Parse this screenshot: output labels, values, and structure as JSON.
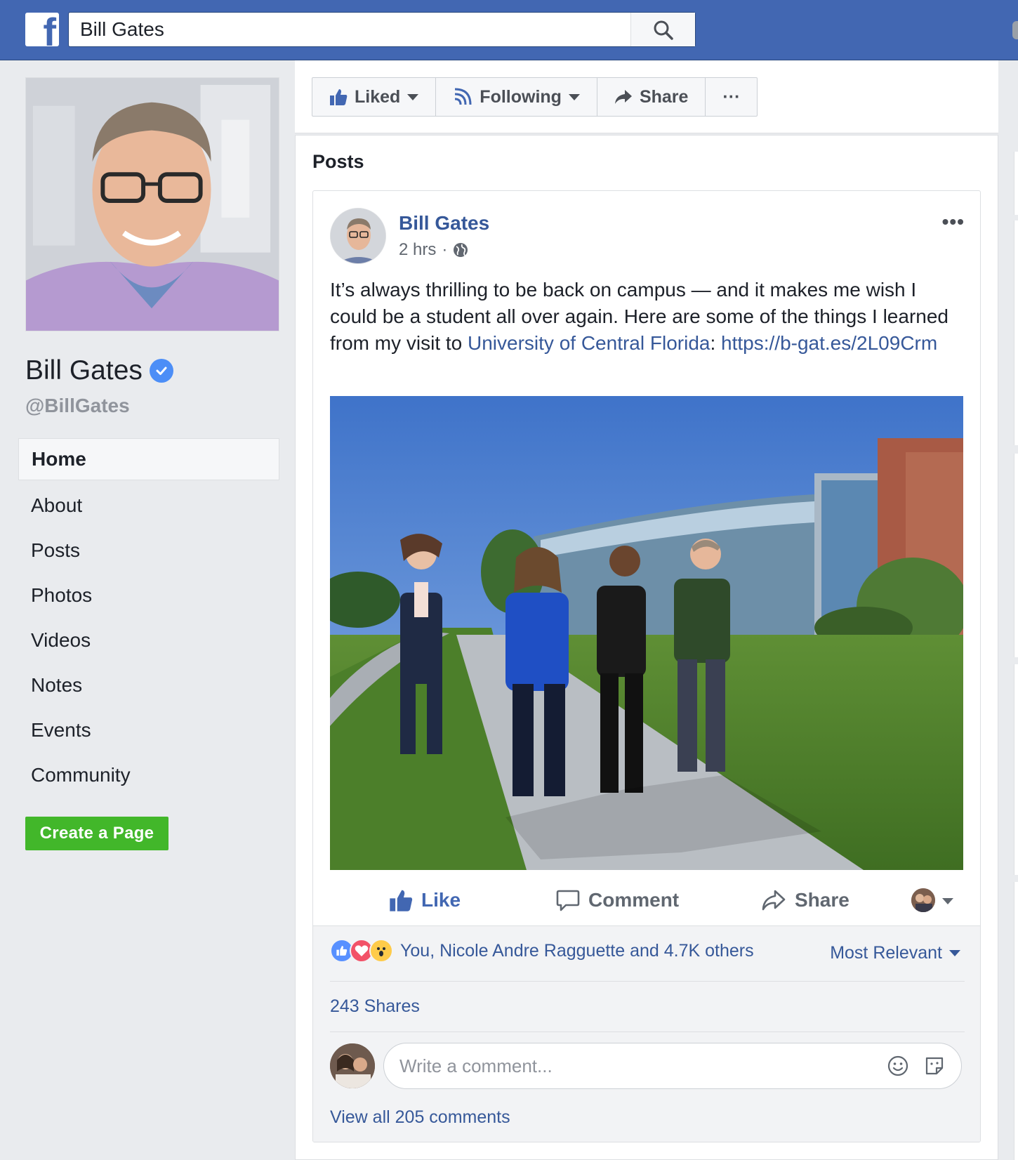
{
  "header": {
    "logo_letter": "f",
    "search_value": "Bill Gates"
  },
  "profile": {
    "name": "Bill Gates",
    "handle": "@BillGates"
  },
  "nav": {
    "items": [
      "Home",
      "About",
      "Posts",
      "Photos",
      "Videos",
      "Notes",
      "Events",
      "Community"
    ],
    "active": "Home"
  },
  "create_page_label": "Create a Page",
  "page_actions": {
    "liked": "Liked",
    "following": "Following",
    "share": "Share",
    "more": "···"
  },
  "posts_section": {
    "title": "Posts"
  },
  "post": {
    "author": "Bill Gates",
    "time": "2 hrs",
    "separator": "·",
    "more": "•••",
    "text_before": "It’s always thrilling to be back on campus — and it makes me wish I could be a student all over again. Here are some of the things I learned from my visit to ",
    "link_ucf": "University of Central Florida",
    "text_colon": ": ",
    "link_url": "https://b-gat.es/2L09Crm",
    "actions": {
      "like": "Like",
      "comment": "Comment",
      "share": "Share"
    },
    "reactions_text": "You, Nicole Andre Ragguette and 4.7K others",
    "sort_label": "Most Relevant",
    "shares": "243 Shares",
    "comment_placeholder": "Write a comment...",
    "view_comments": "View all 205 comments"
  },
  "colors": {
    "brand_blue": "#4267b2",
    "link_blue": "#365899",
    "green": "#42b72a"
  }
}
